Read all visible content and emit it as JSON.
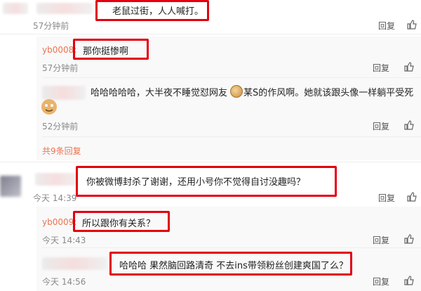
{
  "comments": [
    {
      "text": "老鼠过街，人人喊打。",
      "time": "57分钟前",
      "reply": "回复"
    },
    {
      "user": "yb0008:",
      "text": "那你挺惨啊",
      "time": "57分钟前",
      "reply": "回复"
    },
    {
      "text_a": "哈哈哈哈哈，大半夜不睡觉怼网友",
      "text_b": "某S的作风啊。她就该跟头像一样躺平受死",
      "time": "52分钟前",
      "reply": "回复",
      "more": "共9条回复"
    },
    {
      "text": "你被微博封杀了谢谢，还用小号你不觉得自讨没趣吗？",
      "time": "今天 14:39",
      "reply": "回复"
    },
    {
      "user": "yb0009:",
      "text": "所以跟你有关系？",
      "time": "今天 14:43",
      "reply": "回复"
    },
    {
      "text": "哈哈哈 果然脑回路清奇 不去ins带领粉丝创建爽国了么？",
      "time": "今天 14:56",
      "reply": "回复"
    }
  ],
  "colors": {
    "highlight": "#e3000f",
    "username": "#eb7350",
    "like_icon": "like-icon",
    "comment_icon": "comment-icon"
  }
}
